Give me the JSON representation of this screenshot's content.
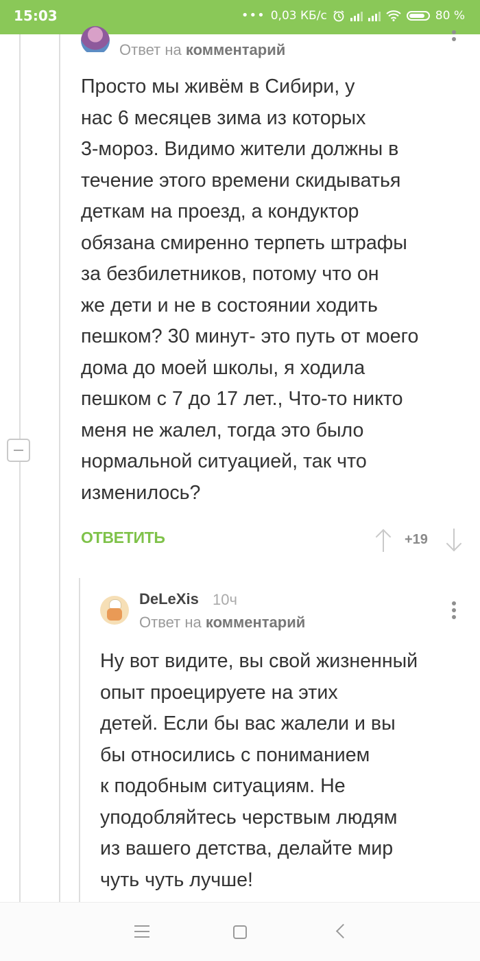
{
  "status_bar": {
    "time": "15:03",
    "network_speed": "0,03 КБ/с",
    "battery": "80 %",
    "icons": [
      "more-dots-icon",
      "alarm-icon",
      "signal-icon",
      "signal-icon",
      "wifi-icon",
      "battery-icon"
    ]
  },
  "comment1": {
    "reply_to_prefix": "Ответ на",
    "reply_to_link": "комментарий",
    "text": "Просто мы живём в Сибири, у\nнас 6 месяцев зима из которых\n3-мороз. Видимо жители должны в\nтечение этого времени скидыватья\nдеткам на проезд, а кондуктор\nобязана смиренно терпеть штрафы\nза безбилетников, потому что он\nже дети и не в состоянии ходить\nпешком? 30 минут- это путь от моего\nдома до моей школы, я ходила\nпешком с 7 до 17 лет., Что-то никто\nменя не жалел, тогда это было\nнормальной ситуацией, так что\nизменилось?",
    "reply_button": "ОТВЕТИТЬ",
    "rating": "+19"
  },
  "comment2": {
    "author": "DeLeXis",
    "age": "10ч",
    "reply_to_prefix": "Ответ на",
    "reply_to_link": "комментарий",
    "text": "Ну вот видите, вы свой жизненный\nопыт проецируете на этих\nдетей. Если бы вас жалели и вы\nбы относились с пониманием\nк подобным ситуациям. Не\nуподобляйтесь черствым людям\nиз вашего детства, делайте мир\nчуть чуть лучше!"
  },
  "colors": {
    "accent": "#8ac858",
    "reply_green": "#7fc24a"
  }
}
